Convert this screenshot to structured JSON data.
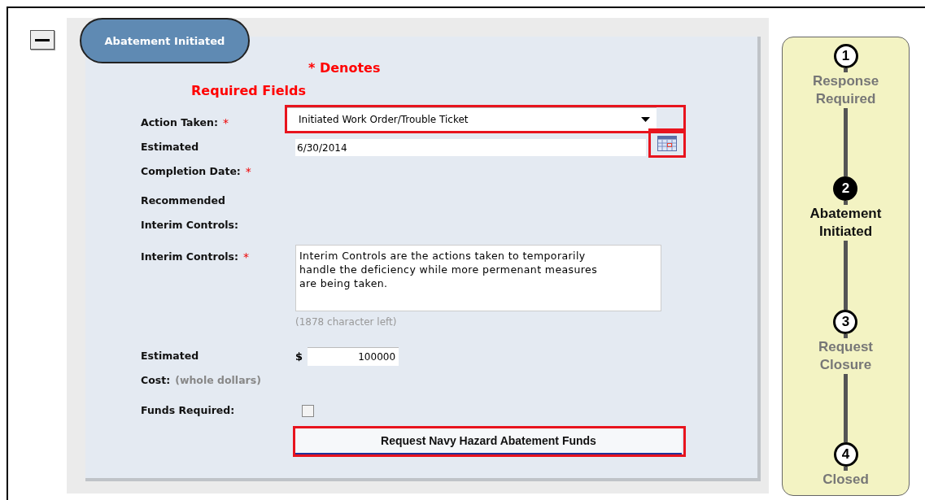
{
  "status_tab": "Abatement Initiated",
  "required_note": [
    "* Denotes",
    "Required Fields"
  ],
  "fields": [
    {
      "kind": "select",
      "label_lines": [
        "Action Taken:"
      ],
      "required_mark": "*",
      "value": "Initiated Work Order/Trouble Ticket",
      "highlighted": true
    },
    {
      "kind": "date",
      "label_lines": [
        "Estimated",
        "Completion Date:"
      ],
      "required_mark": "*",
      "value": "6/30/2014",
      "highlighted": true
    },
    {
      "kind": "none",
      "label_lines": [
        "Recommended",
        "Interim Controls:"
      ]
    },
    {
      "kind": "textarea",
      "label_lines": [
        "Interim Controls:"
      ],
      "required_mark": "*",
      "value": "Interim Controls are the actions taken to temporarily handle the deficiency while more permenant measures are being taken.",
      "counter": "(1878 character left)"
    },
    {
      "kind": "money",
      "label_lines": [
        "Estimated",
        "Cost:"
      ],
      "hint": "(whole dollars)",
      "currency": "$",
      "value": "100000"
    },
    {
      "kind": "checkbox",
      "label_lines": [
        "Funds Required:"
      ],
      "checked": false
    },
    {
      "kind": "button",
      "label": "Request Navy Hazard Abatement Funds",
      "highlighted": true
    }
  ],
  "steps": [
    {
      "number": "1",
      "label_lines": [
        "Response",
        "Required"
      ],
      "selected": false
    },
    {
      "number": "2",
      "label_lines": [
        "Abatement",
        "Initiated"
      ],
      "selected": true
    },
    {
      "number": "3",
      "label_lines": [
        "Request",
        "Closure"
      ],
      "selected": false
    },
    {
      "number": "4",
      "label_lines": [
        "Closed"
      ],
      "selected": false
    }
  ]
}
